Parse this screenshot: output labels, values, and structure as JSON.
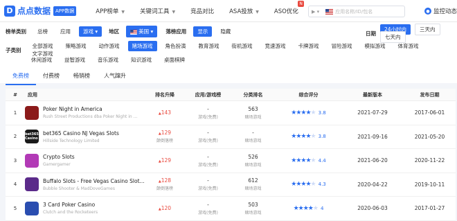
{
  "brand": {
    "logo_letter": "D",
    "name": "点点数据",
    "badge": "APP数据"
  },
  "nav": [
    {
      "label": "APP榜单",
      "caret": true,
      "new": ""
    },
    {
      "label": "关键词工具",
      "caret": true,
      "new": ""
    },
    {
      "label": "竞品对比",
      "caret": false,
      "new": ""
    },
    {
      "label": "ASA投放",
      "caret": true,
      "new": ""
    },
    {
      "label": "ASO优化",
      "caret": false,
      "new": "N"
    }
  ],
  "search": {
    "placeholder": "应用名称/ID/包名"
  },
  "monitor": {
    "label": "监控动态"
  },
  "filters": {
    "chart_type_label": "榜单类别",
    "chart_types": [
      "总榜",
      "应用",
      "游戏"
    ],
    "chart_type_active": "游戏",
    "region_label": "地区",
    "region_value": "美国",
    "rank_app_label": "落榜应用",
    "rank_app_options": [
      "显示",
      "隐藏"
    ],
    "rank_app_active": "显示",
    "date_label": "日期",
    "date_options": [
      "24小时内",
      "三天内",
      "七天内"
    ],
    "date_active": "24小时内",
    "sub_label": "子类别",
    "sub_row1": [
      "全部游戏",
      "策略游戏",
      "动作游戏",
      "赌场游戏",
      "角色扮演",
      "教育游戏",
      "街机游戏",
      "竞速游戏",
      "卡牌游戏",
      "冒险游戏",
      "模拟游戏",
      "体育游戏",
      "文字游戏"
    ],
    "sub_row2": [
      "休闲游戏",
      "益智游戏",
      "音乐游戏",
      "知识游戏",
      "桌面棋牌"
    ],
    "sub_active": "赌场游戏"
  },
  "tabs": [
    "免费榜",
    "付费榜",
    "畅销榜",
    "人气蹿升"
  ],
  "tab_active": "免费榜",
  "table": {
    "headers": [
      "#",
      "应用",
      "排名升降",
      "应用/游戏榜",
      "分类排名",
      "综合评分",
      "最新版本",
      "发布日期"
    ],
    "rows": [
      {
        "idx": "1",
        "name": "Poker Night in America",
        "dev": "Rush Street Productions dba Poker Night in ...",
        "icon_color": "#8b1a1a",
        "rank_change": "143",
        "rank_note": "",
        "kind": "-",
        "kind_sub": "游戏(免费)",
        "cat_rank": "563",
        "cat_name": "赌场游戏",
        "stars": 4,
        "score": "3.8",
        "version": "2021-07-29",
        "date": "2017-06-01"
      },
      {
        "idx": "2",
        "name": "bet365 Casino NJ Vegas Slots",
        "dev": "Hillside Technology Limited",
        "icon_color": "#1a1a1a",
        "icon_text": "bet365 Casino",
        "rank_change": "129",
        "rank_note": "颠倒落榜",
        "kind": "-",
        "kind_sub": "游戏(免费)",
        "cat_rank": "-",
        "cat_name": "赌场游戏",
        "stars": 4,
        "score": "3.8",
        "version": "2021-09-16",
        "date": "2021-05-20"
      },
      {
        "idx": "3",
        "name": "Crypto Slots",
        "dev": "Gamergamer",
        "icon_color": "#b23ab6",
        "rank_change": "129",
        "rank_note": "",
        "kind": "-",
        "kind_sub": "游戏(免费)",
        "cat_rank": "526",
        "cat_name": "赌场游戏",
        "stars": 4,
        "score": "4.4",
        "version": "2021-06-20",
        "date": "2020-11-22"
      },
      {
        "idx": "4",
        "name": "Buffalo Slots - Free Vegas Casino Slot...",
        "dev": "Bubble Shooter & MadDoveGames",
        "icon_color": "#5b2a8a",
        "rank_change": "128",
        "rank_note": "颠倒落榜",
        "kind": "-",
        "kind_sub": "游戏(免费)",
        "cat_rank": "612",
        "cat_name": "赌场游戏",
        "stars": 4,
        "score": "4.3",
        "version": "2020-04-22",
        "date": "2019-10-11"
      },
      {
        "idx": "5",
        "name": "3 Card Poker Casino",
        "dev": "Clutch and the Rocketeers",
        "icon_color": "#2a4db0",
        "rank_change": "120",
        "rank_note": "",
        "kind": "-",
        "kind_sub": "游戏(免费)",
        "cat_rank": "503",
        "cat_name": "赌场游戏",
        "stars": 4,
        "score": "4",
        "version": "2020-06-03",
        "date": "2017-01-27"
      }
    ]
  }
}
